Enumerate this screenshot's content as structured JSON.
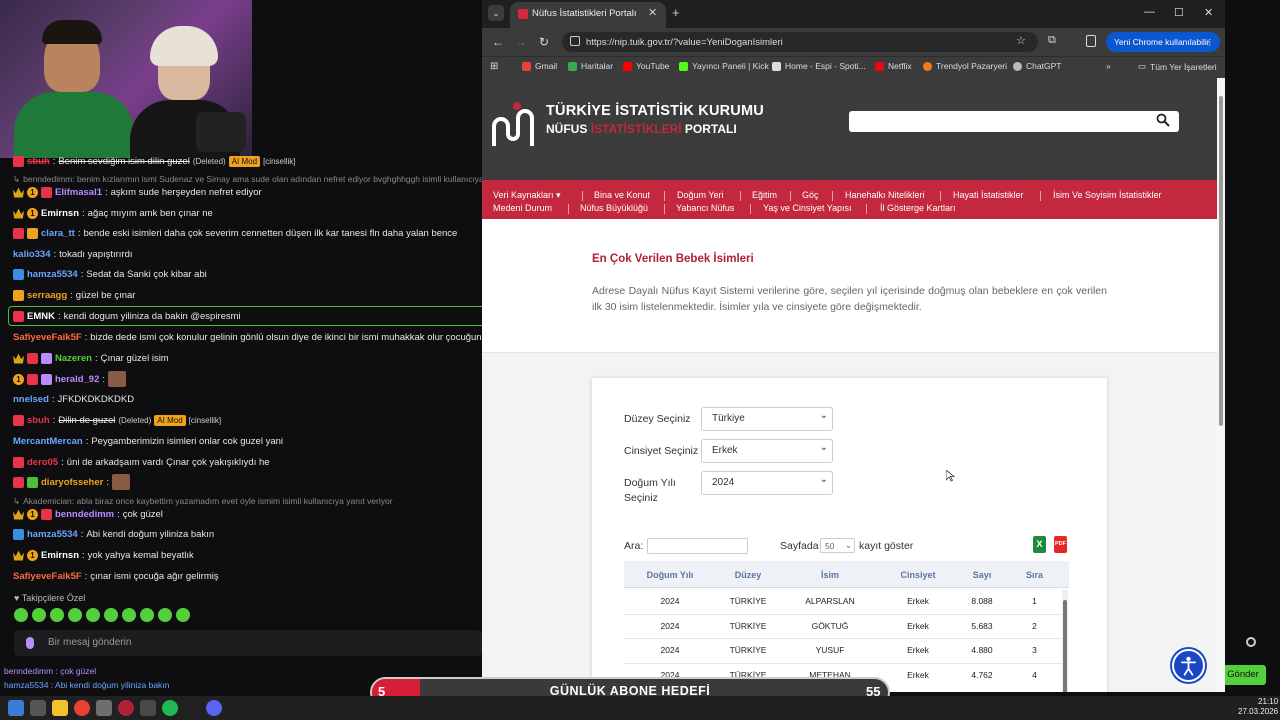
{
  "browser": {
    "tab_title": "Nüfus İstatistikleri Portalı",
    "url": "https://nip.tuik.gov.tr/?value=YeniDoganIsimleri",
    "profile_label": "Yeni Chrome kullanılabilir",
    "bookmarks": [
      "Gmail",
      "Haritalar",
      "YouTube",
      "Yayıncı Paneli | Kick",
      "Home - Espi - Spoti...",
      "Netflix",
      "Trendyol Pazaryeri",
      "ChatGPT"
    ],
    "all_bookmarks": "Tüm Yer İşaretleri"
  },
  "site": {
    "logo_line1": "TÜRKİYE İSTATİSTİK KURUMU",
    "logo_line2_a": "NÜFUS",
    "logo_line2_b": "İSTATİSTİKLERİ",
    "logo_line2_c": "PORTALI",
    "nav_row1": [
      "Veri Kaynakları",
      "Bina ve Konut",
      "Doğum Yeri",
      "Eğitim",
      "Göç",
      "Hanehalkı Nitelikleri",
      "Hayati İstatistikler",
      "İsim Ve Soyisim İstatistikler"
    ],
    "nav_row2": [
      "Medeni Durum",
      "Nüfus Büyüklüğü",
      "Yabancı Nüfus",
      "Yaş ve Cinsiyet Yapısı",
      "İl Gösterge Kartları"
    ],
    "intro_title": "En Çok Verilen Bebek İsimleri",
    "intro_text": "Adrese Dayalı Nüfus Kayıt Sistemi verilerine göre, seçilen yıl içerisinde doğmuş olan bebeklere en çok verilen ilk 30 isim listelenmektedir. İsimler yıla ve cinsiyete göre değişmektedir."
  },
  "form": {
    "level_label": "Düzey Seçiniz",
    "level_value": "Türkiye",
    "gender_label": "Cinsiyet Seçiniz",
    "gender_value": "Erkek",
    "year_label_a": "Doğum Yılı",
    "year_label_b": "Seçiniz",
    "year_value": "2024",
    "search_label": "Ara:",
    "page_prefix": "Sayfada",
    "page_size": "50",
    "page_suffix": "kayıt göster"
  },
  "table": {
    "headers": [
      "Doğum Yılı",
      "Düzey",
      "İsim",
      "Cinsiyet",
      "Sayı",
      "Sıra"
    ],
    "rows": [
      [
        "2024",
        "TÜRKİYE",
        "ALPARSLAN",
        "Erkek",
        "8.088",
        "1"
      ],
      [
        "2024",
        "TÜRKİYE",
        "GÖKTUĞ",
        "Erkek",
        "5.683",
        "2"
      ],
      [
        "2024",
        "TÜRKİYE",
        "YUSUF",
        "Erkek",
        "4.880",
        "3"
      ],
      [
        "2024",
        "TÜRKİYE",
        "METEHAN",
        "Erkek",
        "4.762",
        "4"
      ]
    ]
  },
  "chat": {
    "messages": [
      {
        "user": "sbuh",
        "text": "Benim sevdiğim isim dilin guzel",
        "extra": "(Deleted)",
        "tag": "AI Mod",
        "note": "[cinsellik]",
        "color": "#e9334b"
      },
      {
        "sys": "benndedimm: benim kızlarımın ismi Sudenaz ve Simay ama sude olan adından nefret ediyor bvghghhggh isimli kullanıcıya"
      },
      {
        "user": "Elifmasal1",
        "text": "aşkım sude herşeyden nefret ediyor",
        "color": "#b98cff"
      },
      {
        "user": "Emirnsn",
        "text": "ağaç mıyım amk ben çınar ne",
        "color": "#ffffff"
      },
      {
        "user": "clara_tt",
        "text": "bende eski isimleri daha çok severim cennetten düşen ilk kar tanesi fln daha yalan bence",
        "color": "#6aa6ff"
      },
      {
        "user": "kalio334",
        "text": "tokadı yapıştırırdı",
        "color": "#6aa6ff"
      },
      {
        "user": "hamza5534",
        "text": "Sedat da Sanki çok kibar abi",
        "color": "#6aa6ff"
      },
      {
        "user": "serraagg",
        "text": "güzel be çınar",
        "color": "#f0a31a"
      },
      {
        "user": "EMNK",
        "text": "kendi dogum yiliniza da bakin @espiresmi",
        "color": "#ffffff"
      },
      {
        "user": "SafiyeveFaik5F",
        "text": "bizde dede ismi çok konulur gelinin gönlü olsun diye de ikinci bir ismi muhakkak olur çocuğun",
        "color": "#ff6b3a"
      },
      {
        "user": "Nazeren",
        "text": "Çınar güzel isim",
        "color": "#53d13c"
      },
      {
        "user": "herald_92",
        "text": "",
        "color": "#b98cff"
      },
      {
        "user": "nnelsed",
        "text": "JFKDKDKDKDKD",
        "color": "#6aa6ff"
      },
      {
        "user": "sbuh",
        "text": "Dilin de guzel",
        "extra": "(Deleted)",
        "tag": "AI Mod",
        "note": "[cinsellik]",
        "color": "#e9334b"
      },
      {
        "user": "MercantMercan",
        "text": "Peygamberimizin isimleri onlar cok guzel yani",
        "color": "#6aa6ff"
      },
      {
        "user": "dero05",
        "text": "üni de arkadşaım vardı Çınar çok yakışıklıydı he",
        "color": "#e9334b"
      },
      {
        "user": "diaryofsseher",
        "text": "",
        "color": "#f0a31a"
      },
      {
        "sys": "Akademician: abla biraz once kaybettim yazamadım evet oyle ismim isimli kullanıcıya yanıt veriyor"
      },
      {
        "user": "benndedimm",
        "text": "çok güzel",
        "color": "#b98cff"
      },
      {
        "user": "hamza5534",
        "text": "Abi kendi doğum yiliniza bakın",
        "color": "#6aa6ff"
      },
      {
        "user": "Emirnsn",
        "text": "yok yahya kemal beyatlık",
        "color": "#ffffff"
      },
      {
        "user": "SafiyeveFaik5F",
        "text": "çınar ismi çocuğa ağır gelirmiş",
        "color": "#ff6b3a"
      }
    ],
    "followers_only": "Takipçilere Özel",
    "input_placeholder": "Bir mesaj gönderin",
    "send_label": "Gönder",
    "overlay_1": "benndedimm : çok güzel",
    "overlay_2": "hamza5534 : Abi kendi doğum yiliniza bakın"
  },
  "goal": {
    "current": "5",
    "label": "GÜNLÜK ABONE HEDEFİ",
    "target": "55",
    "progress": 0.09
  },
  "taskbar": {
    "time": "21:10",
    "date": "27.03.2026"
  }
}
